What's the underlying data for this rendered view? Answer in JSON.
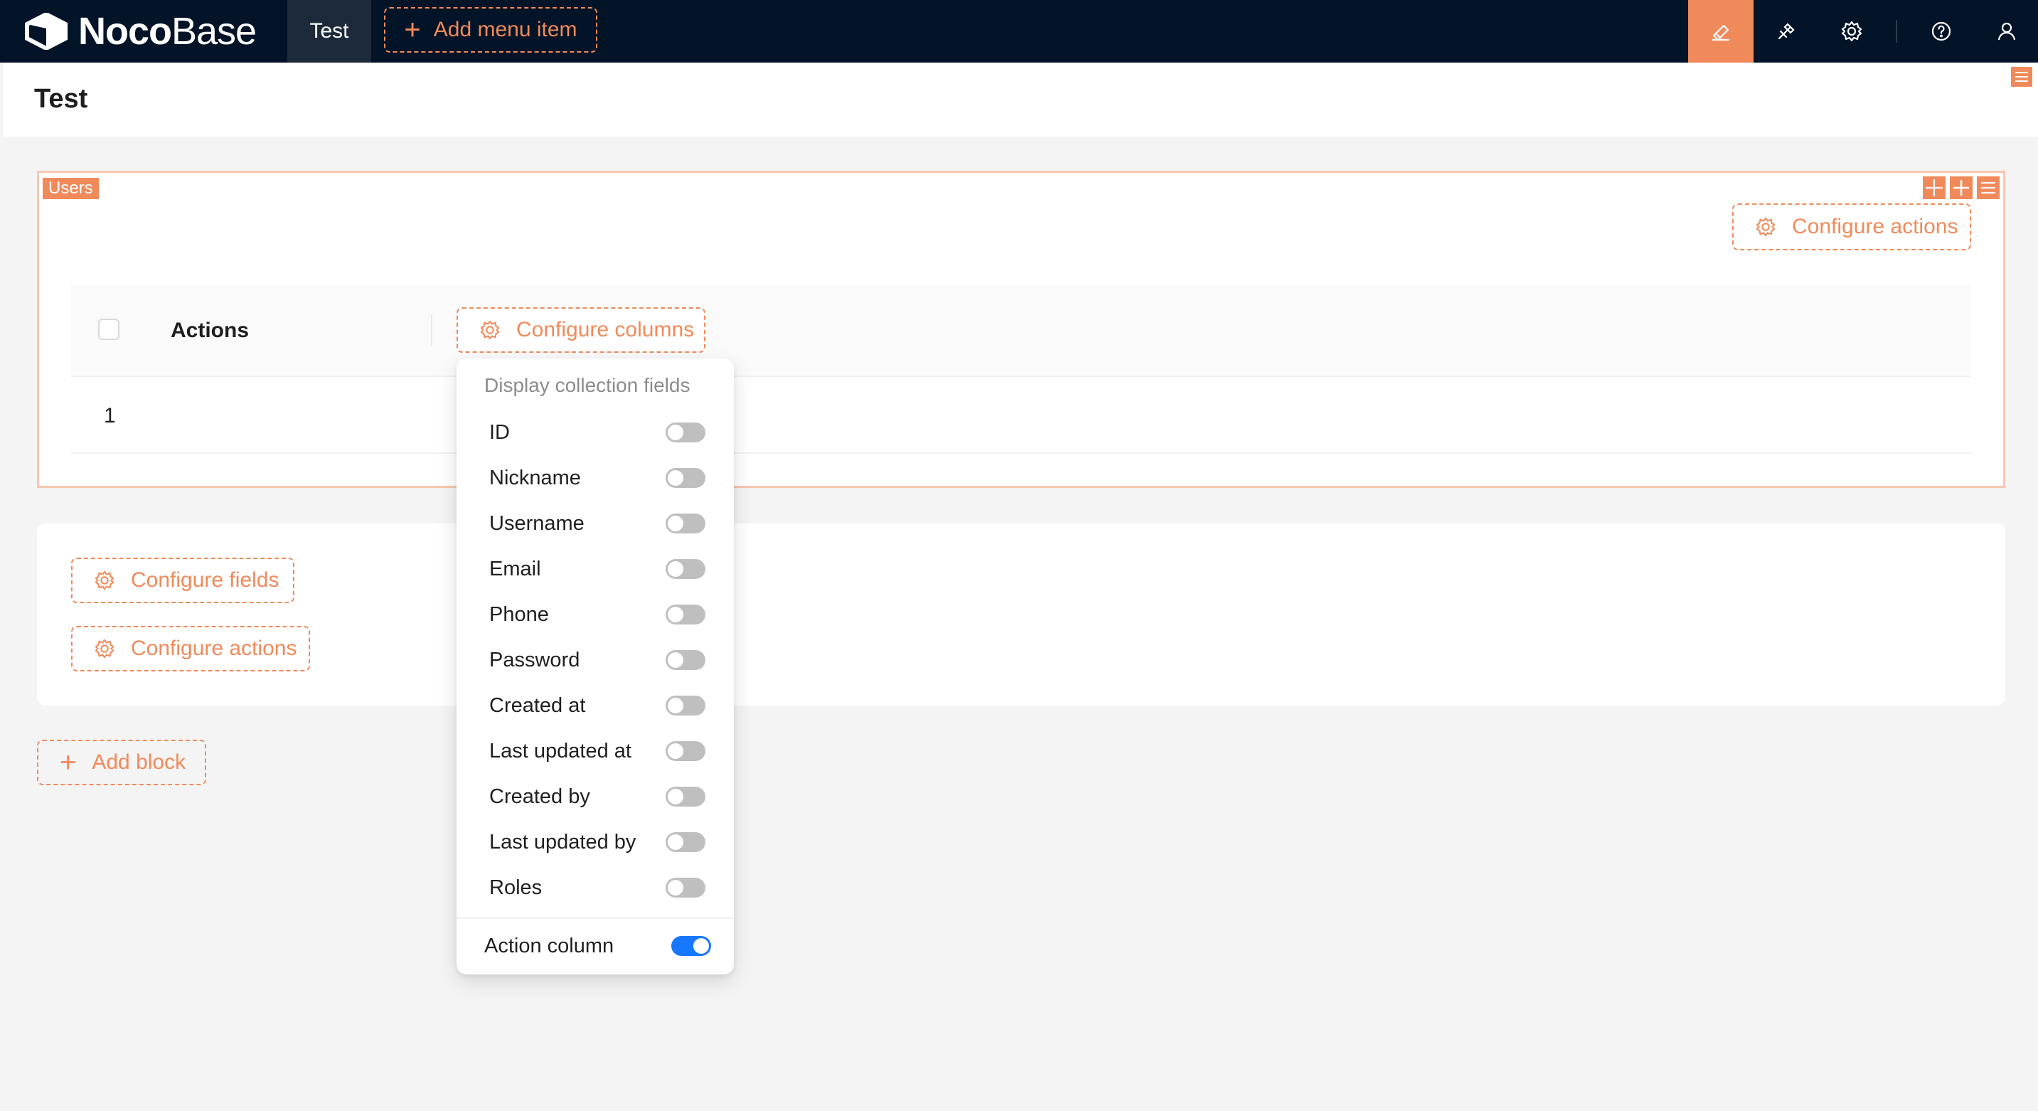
{
  "topbar": {
    "logo_bold": "Noco",
    "logo_light": "Base",
    "menu_tab": "Test",
    "add_menu_item": "Add menu item",
    "icons": [
      "ui-editor-icon",
      "plugin-manager-icon",
      "settings-icon",
      "help-icon",
      "user-icon"
    ],
    "accent": "#f08a5b",
    "background": "#041428"
  },
  "page": {
    "title": "Test"
  },
  "users_block": {
    "badge": "Users",
    "configure_actions": "Configure actions",
    "table": {
      "header_actions": "Actions",
      "configure_columns": "Configure columns",
      "rows": [
        "1"
      ]
    }
  },
  "form_block": {
    "configure_fields": "Configure fields",
    "configure_actions": "Configure actions"
  },
  "add_block": "Add block",
  "dropdown": {
    "title": "Display collection fields",
    "fields": [
      {
        "label": "ID",
        "on": false
      },
      {
        "label": "Nickname",
        "on": false
      },
      {
        "label": "Username",
        "on": false
      },
      {
        "label": "Email",
        "on": false
      },
      {
        "label": "Phone",
        "on": false
      },
      {
        "label": "Password",
        "on": false
      },
      {
        "label": "Created at",
        "on": false
      },
      {
        "label": "Last updated at",
        "on": false
      },
      {
        "label": "Created by",
        "on": false
      },
      {
        "label": "Last updated by",
        "on": false
      },
      {
        "label": "Roles",
        "on": false
      }
    ],
    "action_column": {
      "label": "Action column",
      "on": true
    }
  }
}
